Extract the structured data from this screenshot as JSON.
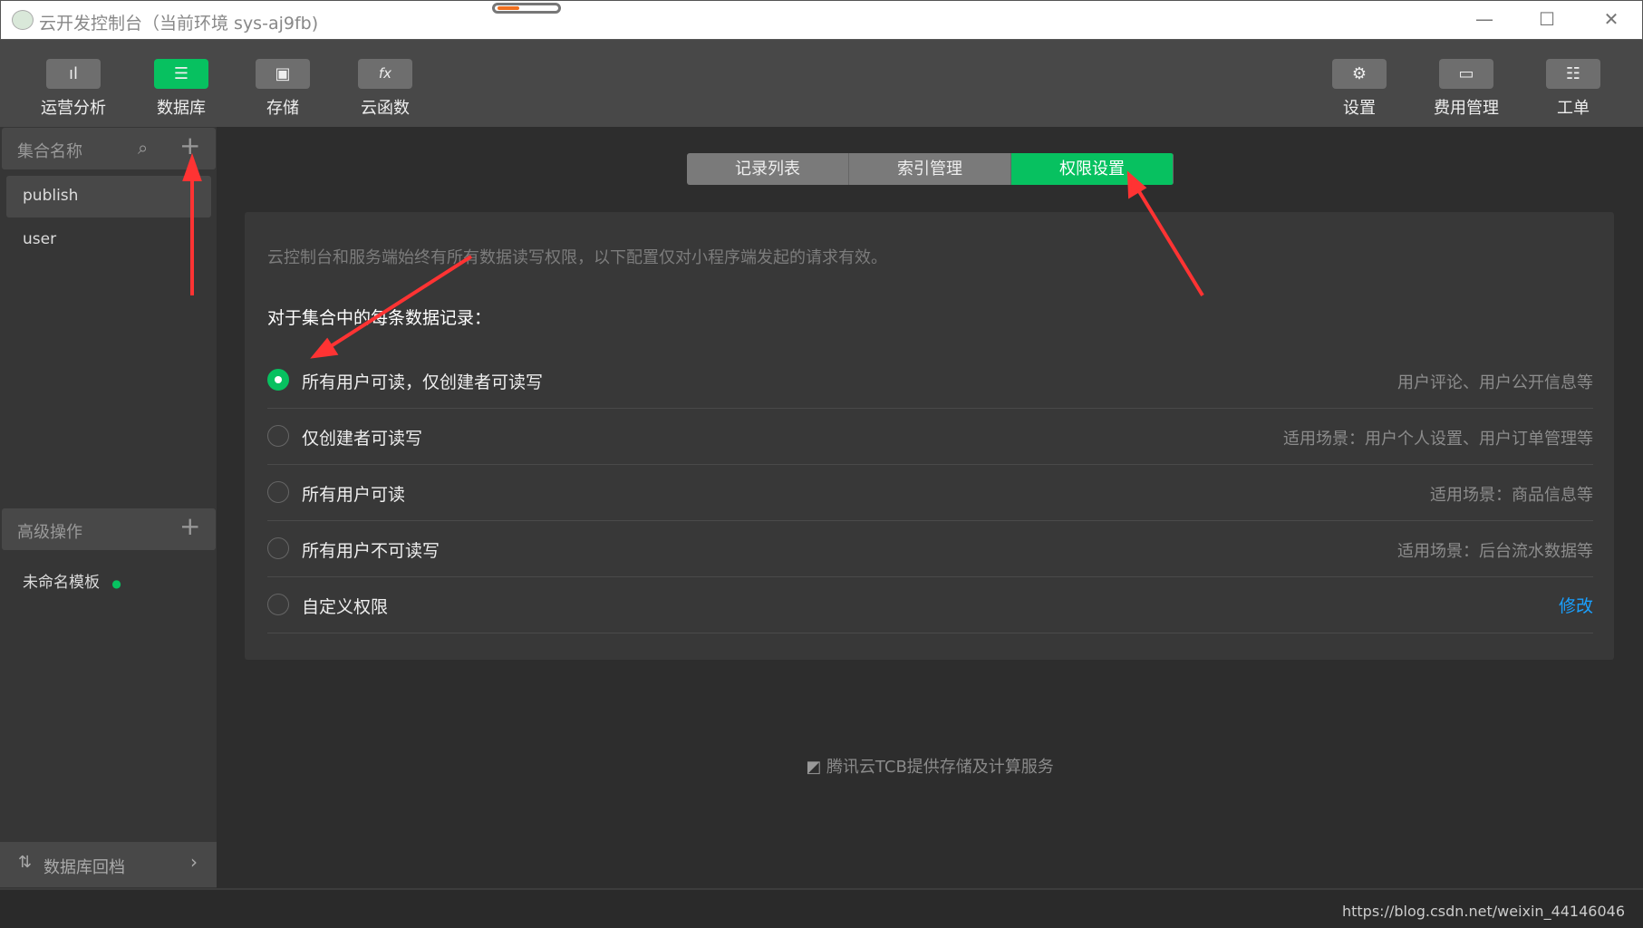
{
  "window": {
    "title": "云开发控制台（当前环境 sys-aj9fb)",
    "minimize": "—",
    "maximize": "☐",
    "close": "✕"
  },
  "toolbar": {
    "left": [
      {
        "label": "运营分析",
        "icon": "bar-chart-icon",
        "glyph": "📊"
      },
      {
        "label": "数据库",
        "icon": "database-icon",
        "glyph": "☰",
        "active": true
      },
      {
        "label": "存储",
        "icon": "floppy-disk-icon",
        "glyph": "💾"
      },
      {
        "label": "云函数",
        "icon": "function-icon",
        "glyph": "fx"
      }
    ],
    "right": [
      {
        "label": "设置",
        "icon": "gear-icon",
        "glyph": "⚙"
      },
      {
        "label": "费用管理",
        "icon": "ticket-icon",
        "glyph": "▭"
      },
      {
        "label": "工单",
        "icon": "ticket-question-icon",
        "glyph": "🗒"
      }
    ]
  },
  "sidebar": {
    "collections_header": "集合名称",
    "collections": [
      "publish",
      "user"
    ],
    "selected_collection": "publish",
    "advanced_header": "高级操作",
    "templates": [
      "未命名模板"
    ],
    "template_status_color": "#07c160",
    "rollback": "数据库回档"
  },
  "tabs": [
    "记录列表",
    "索引管理",
    "权限设置"
  ],
  "active_tab": "权限设置",
  "permissions": {
    "info": "云控制台和服务端始终有所有数据读写权限，以下配置仅对小程序端发起的请求有效。",
    "heading": "对于集合中的每条数据记录：",
    "options": [
      {
        "label": "所有用户可读，仅创建者可读写",
        "desc": "用户评论、用户公开信息等",
        "selected": true
      },
      {
        "label": "仅创建者可读写",
        "desc": "适用场景：用户个人设置、用户订单管理等"
      },
      {
        "label": "所有用户可读",
        "desc": "适用场景：商品信息等"
      },
      {
        "label": "所有用户不可读写",
        "desc": "适用场景：后台流水数据等"
      },
      {
        "label": "自定义权限",
        "link": "修改"
      }
    ]
  },
  "footer": "腾讯云TCB提供存储及计算服务",
  "status_url": "https://blog.csdn.net/weixin_44146046",
  "colors": {
    "accent": "#07c160",
    "link": "#1aa0ff",
    "annotation": "#ff3333"
  }
}
